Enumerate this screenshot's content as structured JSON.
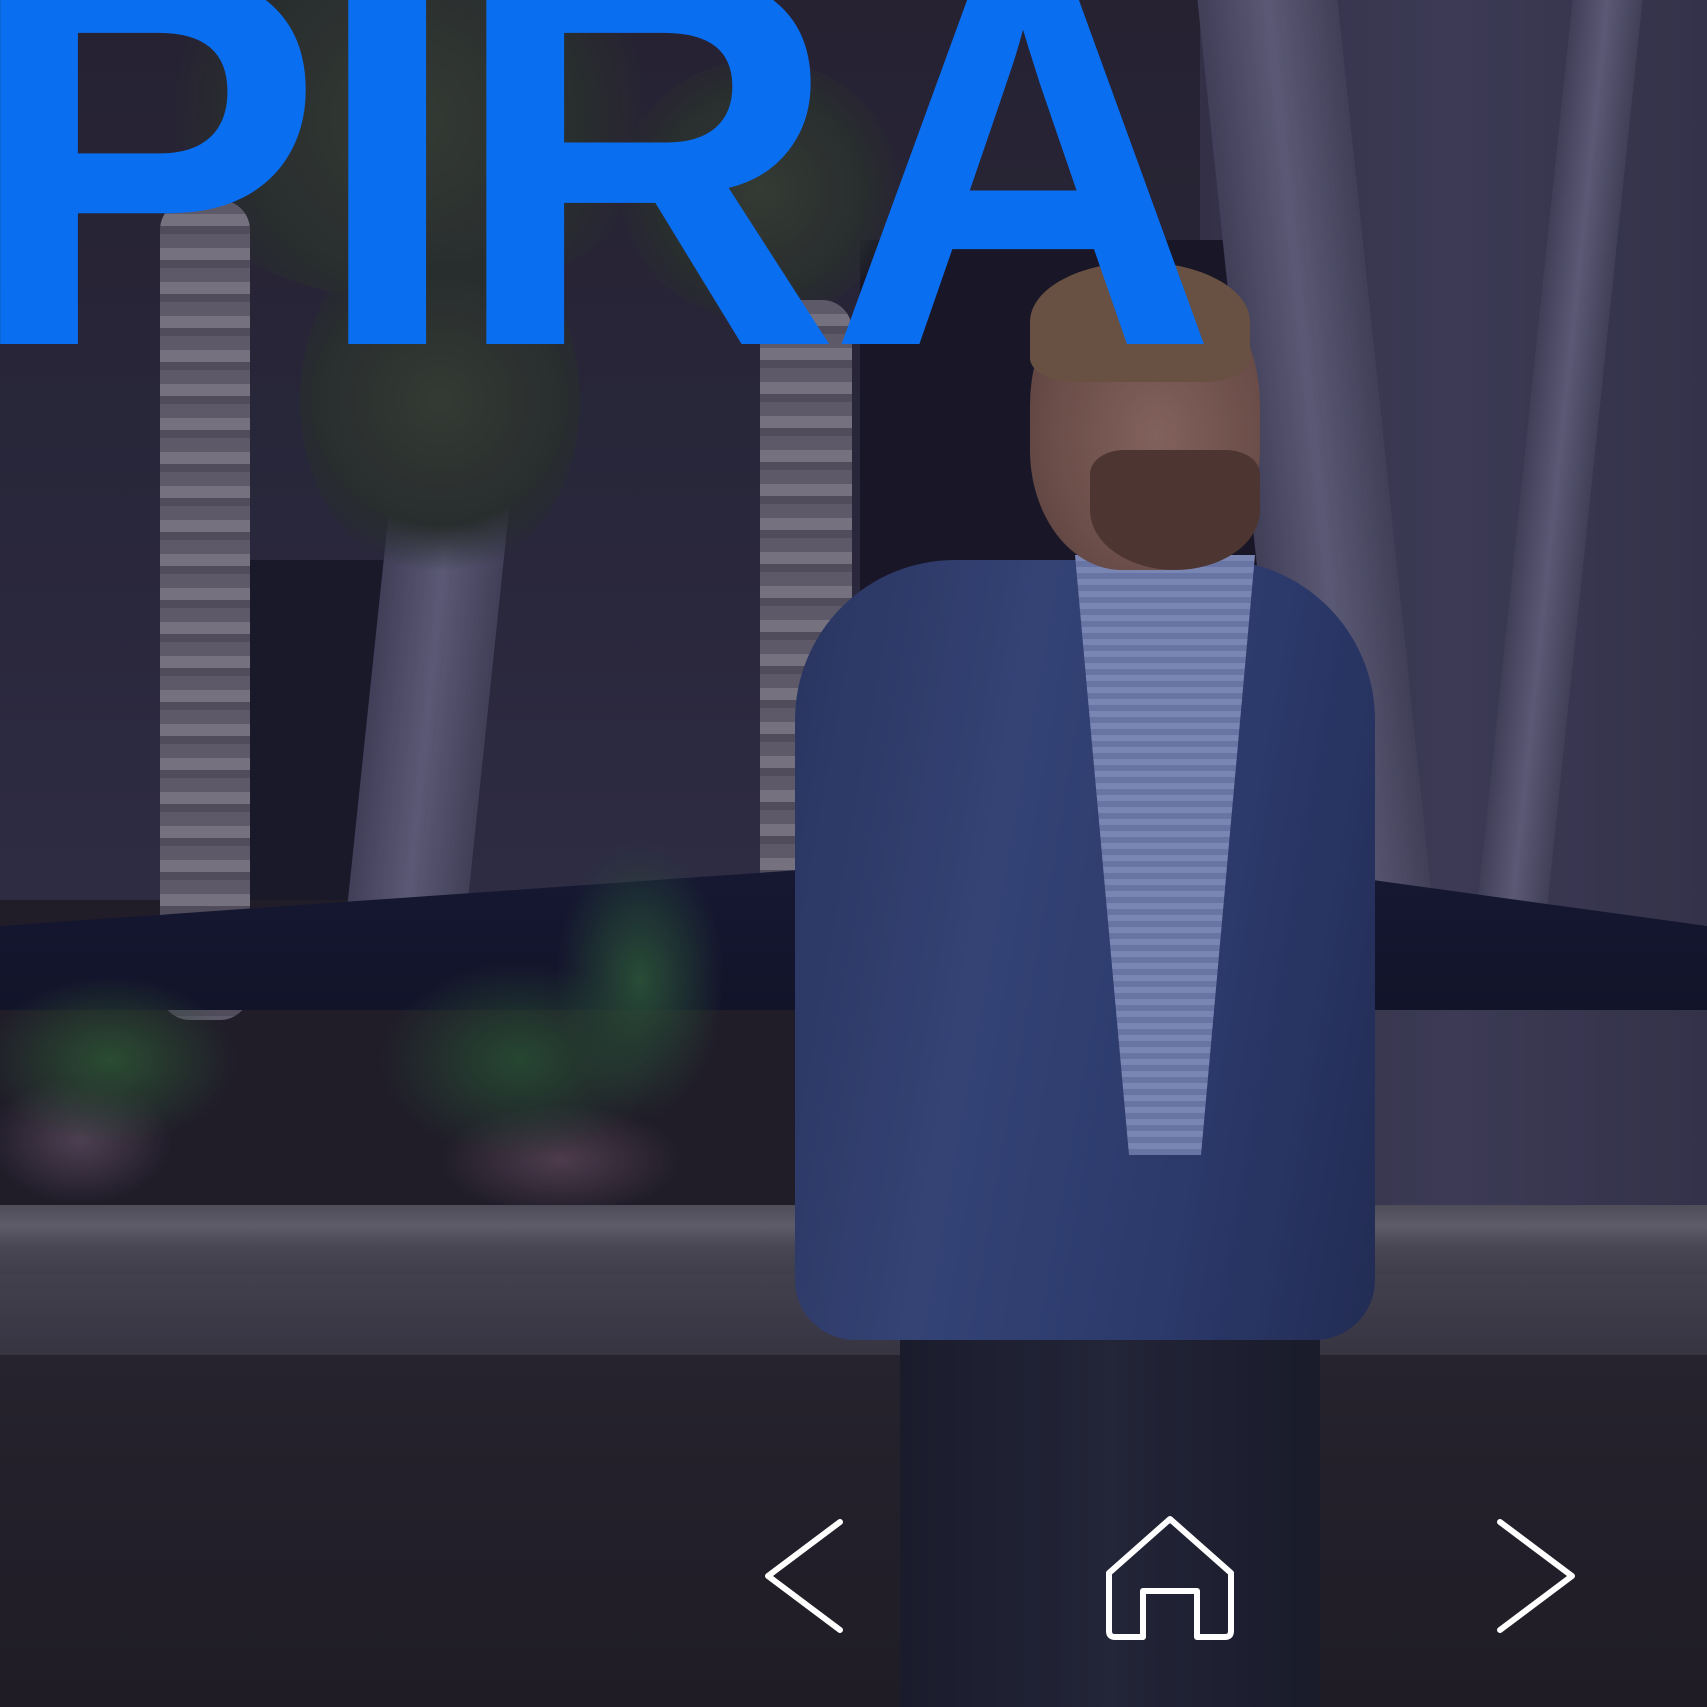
{
  "hero": {
    "headline": "PIRA",
    "accent_color": "#0a6ef0"
  },
  "navigation": {
    "prev": {
      "icon": "chevron-left-icon",
      "color": "#ffffff"
    },
    "home": {
      "icon": "home-icon",
      "color": "#ffffff"
    },
    "next": {
      "icon": "chevron-right-icon",
      "color": "#ffffff"
    }
  }
}
